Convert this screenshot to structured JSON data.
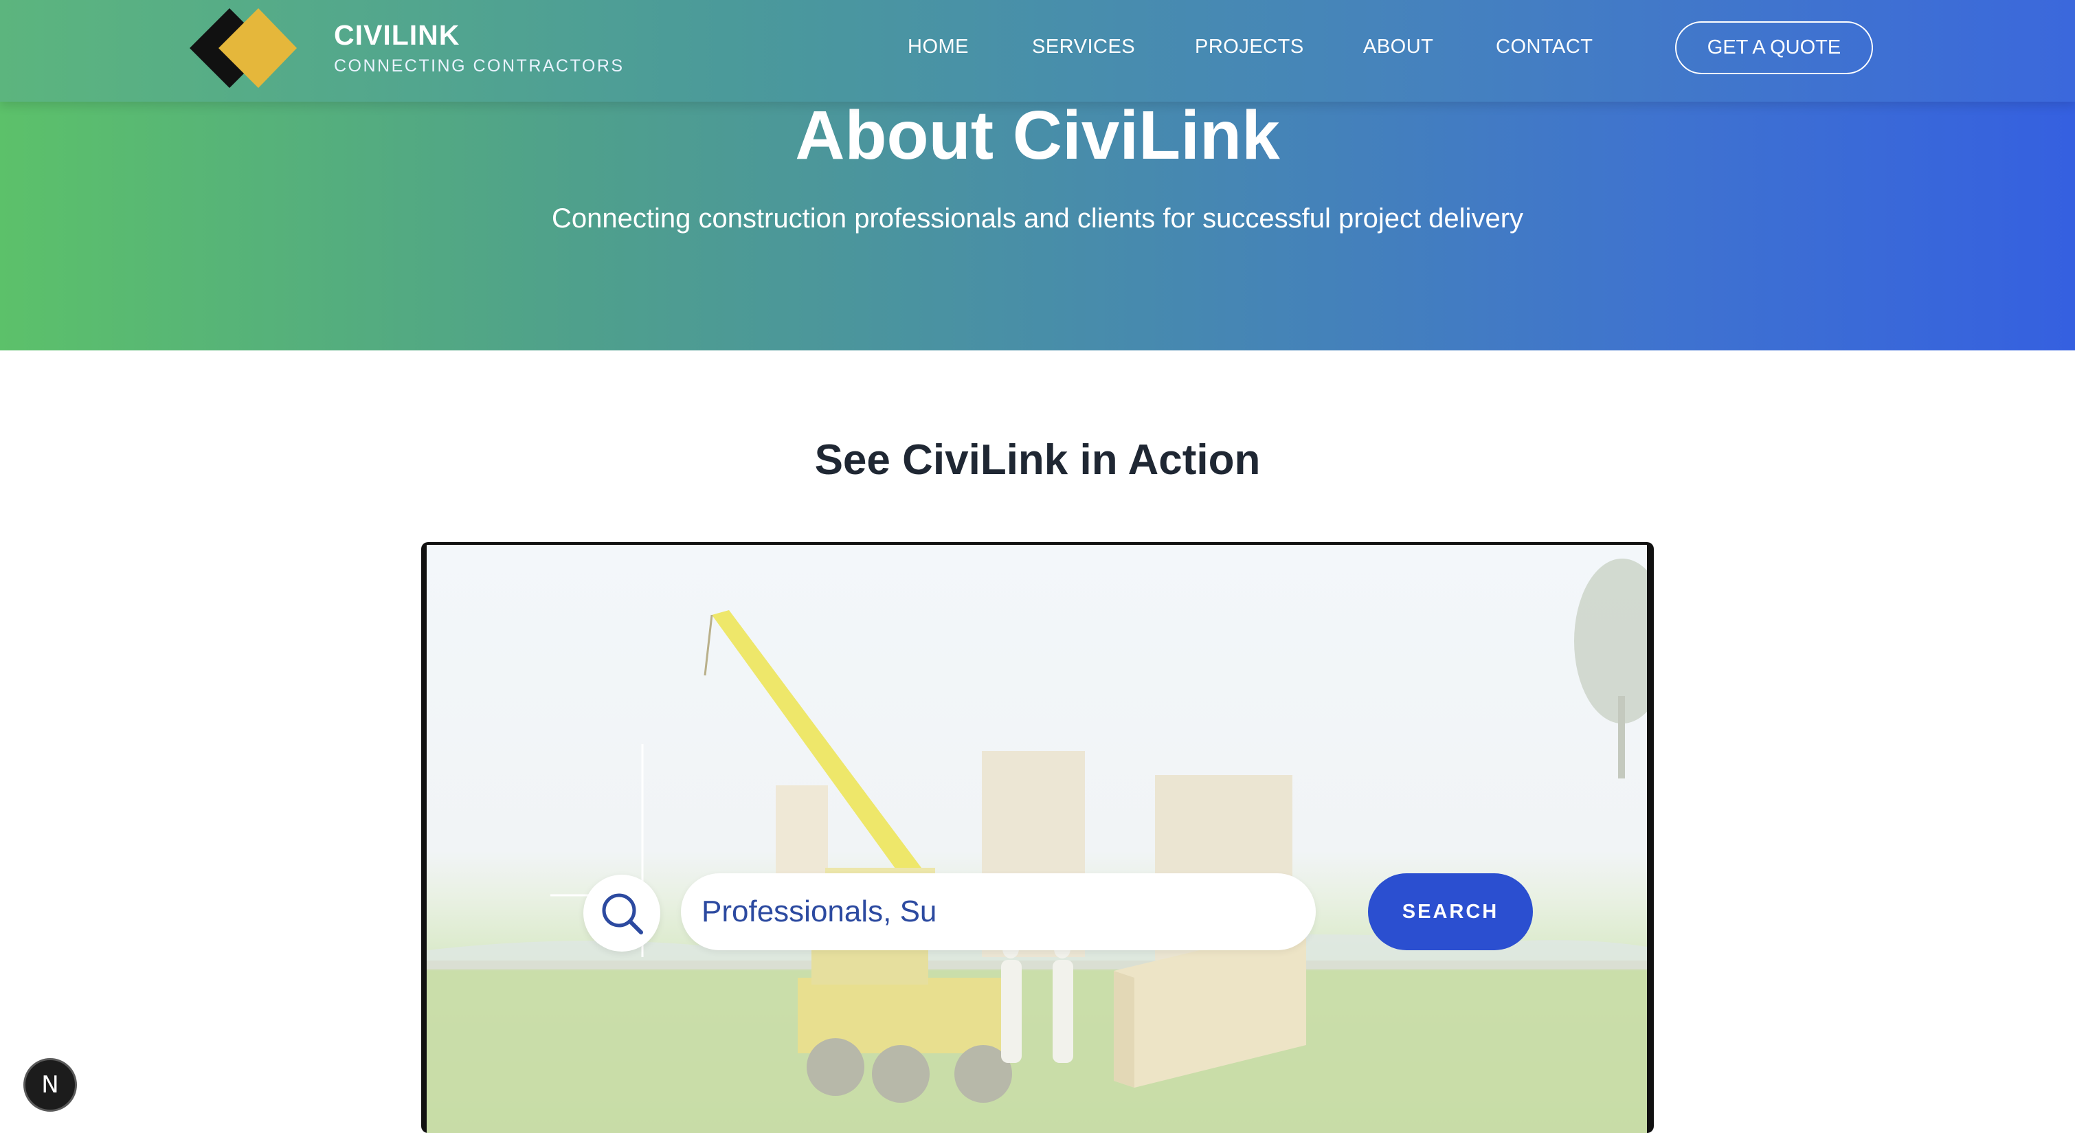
{
  "brand": {
    "name": "CIVILINK",
    "tagline": "CONNECTING CONTRACTORS"
  },
  "nav": {
    "items": [
      {
        "label": "HOME"
      },
      {
        "label": "SERVICES"
      },
      {
        "label": "PROJECTS"
      },
      {
        "label": "ABOUT"
      },
      {
        "label": "CONTACT"
      }
    ],
    "cta_label": "GET A QUOTE"
  },
  "hero": {
    "title": "About CiviLink",
    "subtitle": "Connecting construction professionals and clients for successful project delivery"
  },
  "demo": {
    "title": "See CiviLink in Action",
    "search_value": "Professionals, Su",
    "search_button": "SEARCH"
  },
  "dev_badge": {
    "letter": "N"
  },
  "colors": {
    "gradient_start": "#5cc16a",
    "gradient_end": "#3560e0",
    "logo_gold": "#e5b73b",
    "logo_black": "#111111",
    "search_button": "#2b4fd0",
    "heading_dark": "#1f2733"
  },
  "icons": {
    "logo": "diamond-logo-icon",
    "search": "magnifier-icon"
  }
}
